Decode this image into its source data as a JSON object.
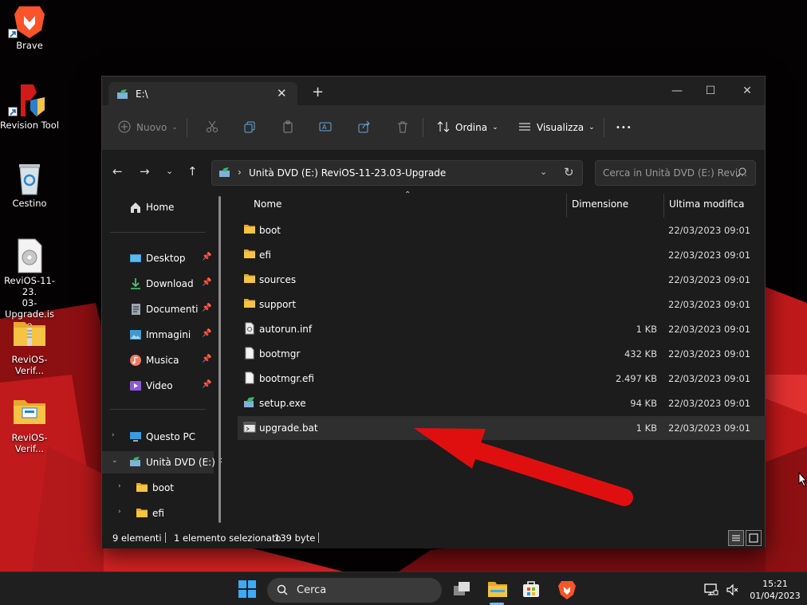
{
  "desktop": {
    "icons": [
      {
        "label": "Brave",
        "icon": "brave-lion-icon",
        "shortcut": true
      },
      {
        "label": "Revision Tool",
        "icon": "revision-tool-icon",
        "shortcut": true
      },
      {
        "label": "Cestino",
        "icon": "recycle-bin-icon",
        "shortcut": false
      },
      {
        "label": "ReviOS-11-23.03-Upgrade.iso",
        "label_lines": [
          "ReviOS-11-23.",
          "03-Upgrade.is",
          "o"
        ],
        "icon": "disc-image-icon",
        "shortcut": false
      },
      {
        "label": "ReviOS-Verif...",
        "icon": "zip-folder-icon",
        "shortcut": false
      },
      {
        "label": "ReviOS-Verif...",
        "icon": "folder-icon",
        "shortcut": false
      }
    ]
  },
  "window": {
    "tab_title": "E:\\",
    "toolbar": {
      "new_label": "Nuovo",
      "sort_label": "Ordina",
      "view_label": "Visualizza",
      "more_label": "•••"
    },
    "address": {
      "path": "Unità DVD (E:) ReviOS-11-23.03-Upgrade"
    },
    "search": {
      "placeholder": "Cerca in Unità DVD (E:) Revi..."
    },
    "sidebar": {
      "home": "Home",
      "quick_access": [
        {
          "label": "Desktop",
          "icon": "desktop-icon"
        },
        {
          "label": "Download",
          "icon": "download-icon"
        },
        {
          "label": "Documenti",
          "icon": "documents-icon"
        },
        {
          "label": "Immagini",
          "icon": "pictures-icon"
        },
        {
          "label": "Musica",
          "icon": "music-icon"
        },
        {
          "label": "Video",
          "icon": "video-icon"
        }
      ],
      "tree": [
        {
          "label": "Questo PC",
          "icon": "this-pc-icon",
          "expanded": false
        },
        {
          "label": "Unità DVD (E:) R",
          "icon": "dvd-drive-icon",
          "expanded": true,
          "selected": true
        },
        {
          "label": "boot",
          "icon": "folder-icon",
          "expanded": false
        },
        {
          "label": "efi",
          "icon": "folder-icon",
          "expanded": false
        }
      ]
    },
    "columns": {
      "name": "Nome",
      "size": "Dimensione",
      "modified": "Ultima modifica"
    },
    "files": [
      {
        "name": "boot",
        "size": "",
        "modified": "22/03/2023 09:01",
        "type": "folder"
      },
      {
        "name": "efi",
        "size": "",
        "modified": "22/03/2023 09:01",
        "type": "folder"
      },
      {
        "name": "sources",
        "size": "",
        "modified": "22/03/2023 09:01",
        "type": "folder"
      },
      {
        "name": "support",
        "size": "",
        "modified": "22/03/2023 09:01",
        "type": "folder"
      },
      {
        "name": "autorun.inf",
        "size": "1 KB",
        "modified": "22/03/2023 09:01",
        "type": "inf"
      },
      {
        "name": "bootmgr",
        "size": "432 KB",
        "modified": "22/03/2023 09:01",
        "type": "file"
      },
      {
        "name": "bootmgr.efi",
        "size": "2.497 KB",
        "modified": "22/03/2023 09:01",
        "type": "file"
      },
      {
        "name": "setup.exe",
        "size": "94 KB",
        "modified": "22/03/2023 09:01",
        "type": "exe"
      },
      {
        "name": "upgrade.bat",
        "size": "1 KB",
        "modified": "22/03/2023 09:01",
        "type": "bat",
        "selected": true
      }
    ],
    "status": {
      "count": "9 elementi",
      "selection": "1 elemento selezionato",
      "selection_size": "139 byte"
    }
  },
  "taskbar": {
    "search_label": "Cerca",
    "time": "15:21",
    "date": "01/04/2023"
  },
  "colors": {
    "accent_folder": "#f5c442",
    "arrow": "#e00f0f",
    "window_bg": "#1c1c1c",
    "toolbar_bg": "#2c2c2c"
  }
}
